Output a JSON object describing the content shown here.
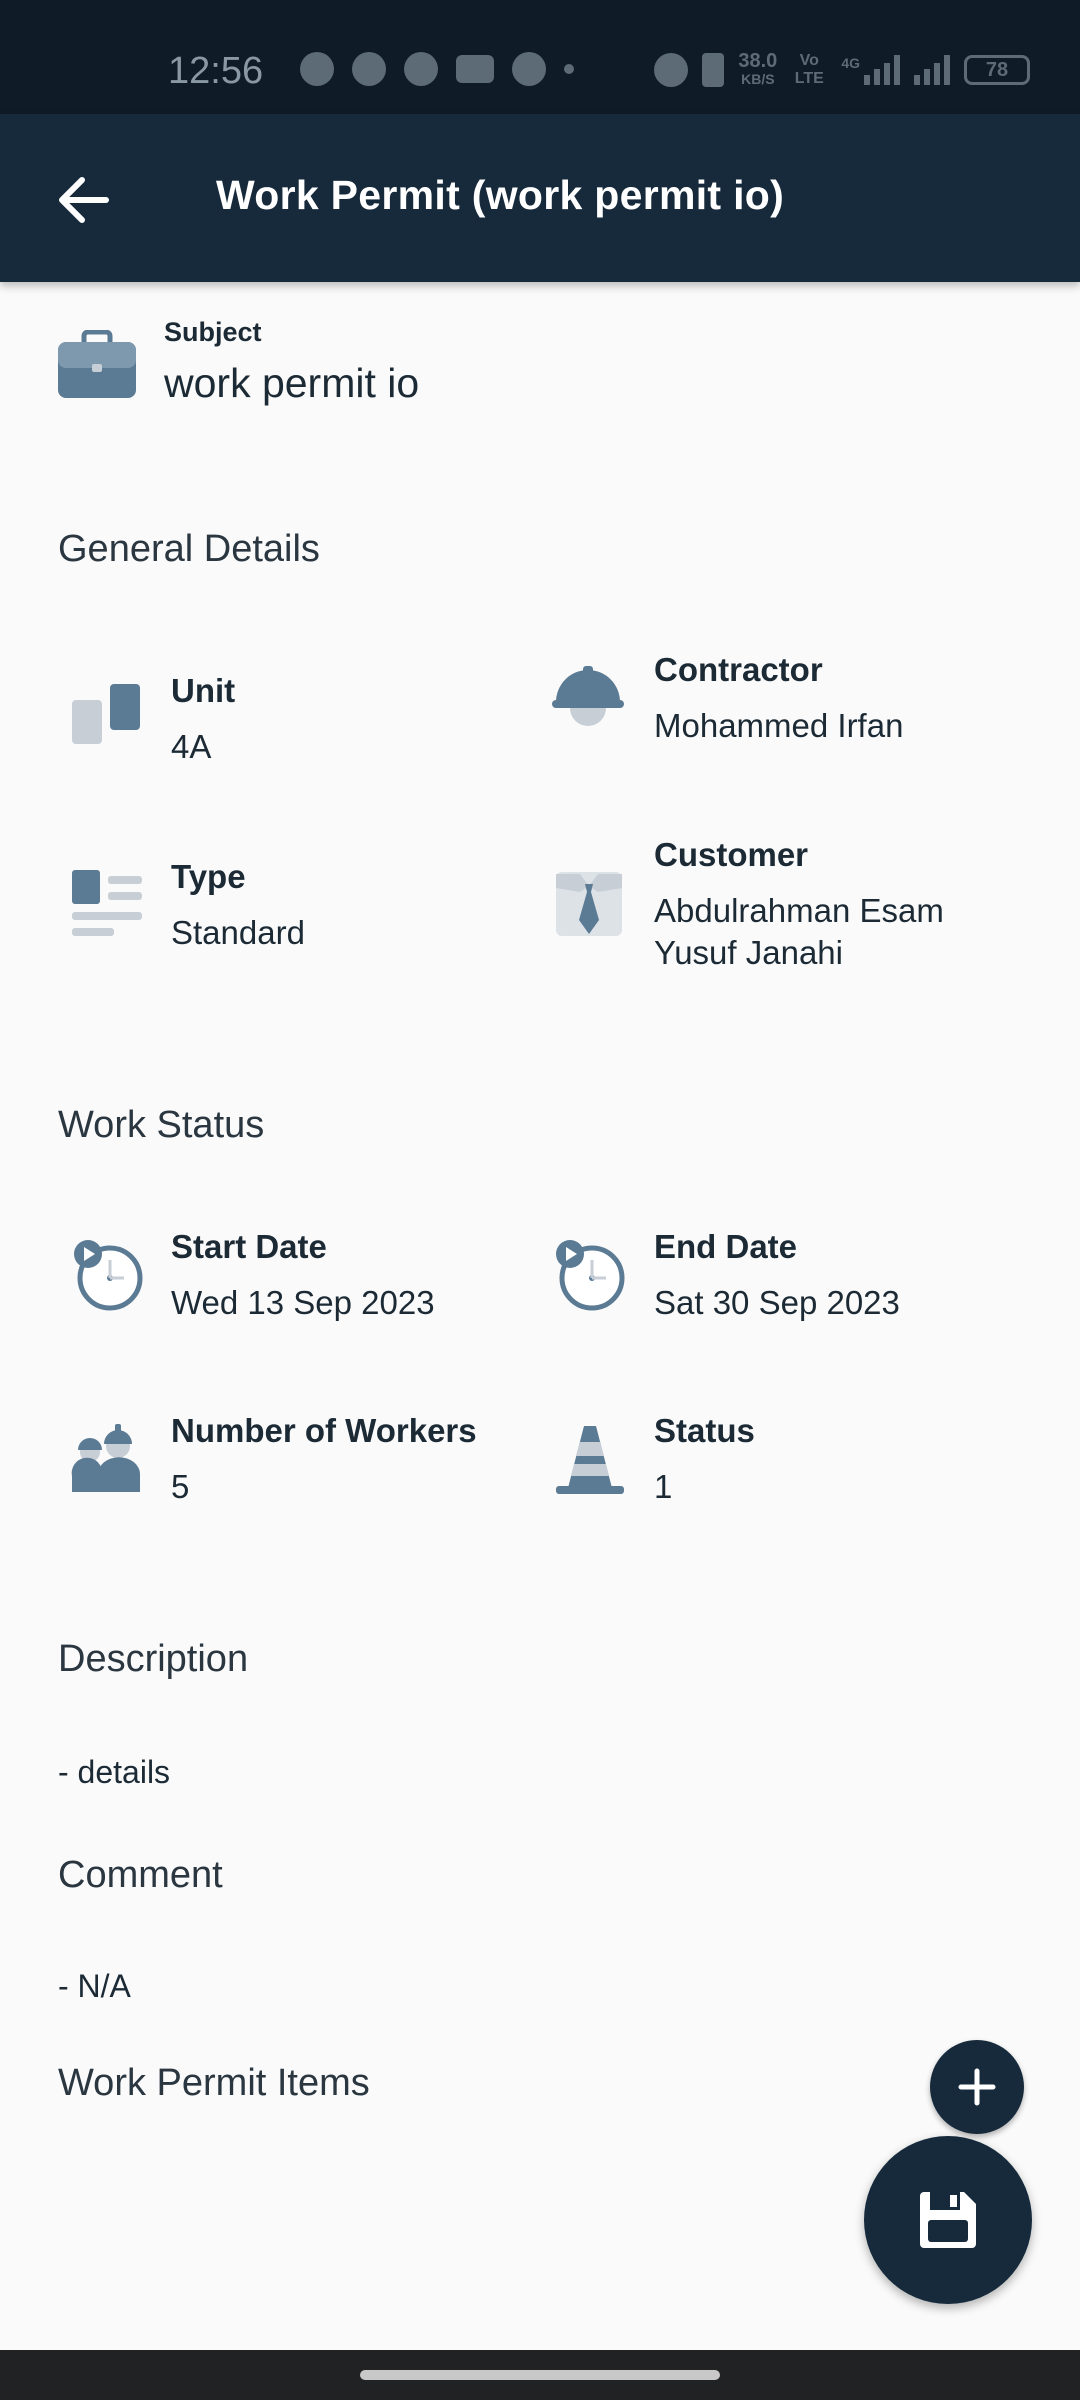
{
  "status_bar": {
    "time": "12:56",
    "net_speed_value": "38.0",
    "net_speed_unit": "KB/S",
    "volte": "Vo LTE",
    "network": "4G",
    "battery": "78"
  },
  "app_bar": {
    "title": "Work Permit (work permit io)",
    "back_icon": "arrow-left-icon"
  },
  "subject": {
    "label": "Subject",
    "value": "work permit io",
    "icon": "briefcase-icon"
  },
  "general_details": {
    "title": "General Details",
    "unit": {
      "label": "Unit",
      "value": "4A",
      "icon": "unit-blocks-icon"
    },
    "contractor": {
      "label": "Contractor",
      "value": "Mohammed Irfan",
      "icon": "hard-hat-icon"
    },
    "type": {
      "label": "Type",
      "value": "Standard",
      "icon": "list-type-icon"
    },
    "customer": {
      "label": "Customer",
      "value_line1": "Abdulrahman Esam",
      "value_line2": "Yusuf Janahi",
      "icon": "shirt-tie-icon"
    }
  },
  "work_status": {
    "title": "Work Status",
    "start_date": {
      "label": "Start Date",
      "value": "Wed 13 Sep 2023",
      "icon": "clock-start-icon"
    },
    "end_date": {
      "label": "End Date",
      "value": "Sat 30 Sep 2023",
      "icon": "clock-start-icon"
    },
    "workers": {
      "label": "Number of Workers",
      "value": "5",
      "icon": "workers-icon"
    },
    "status": {
      "label": "Status",
      "value": "1",
      "icon": "traffic-cone-icon"
    }
  },
  "description": {
    "title": "Description",
    "value": "- details"
  },
  "comment": {
    "title": "Comment",
    "value": "- N/A"
  },
  "items": {
    "title": "Work Permit Items"
  },
  "fabs": {
    "add_icon": "plus-icon",
    "save_icon": "floppy-disk-icon"
  },
  "colors": {
    "app_bar": "#162a3b",
    "icon_primary": "#5b7a94",
    "icon_secondary": "#c7ced6",
    "background": "#fafafa"
  }
}
